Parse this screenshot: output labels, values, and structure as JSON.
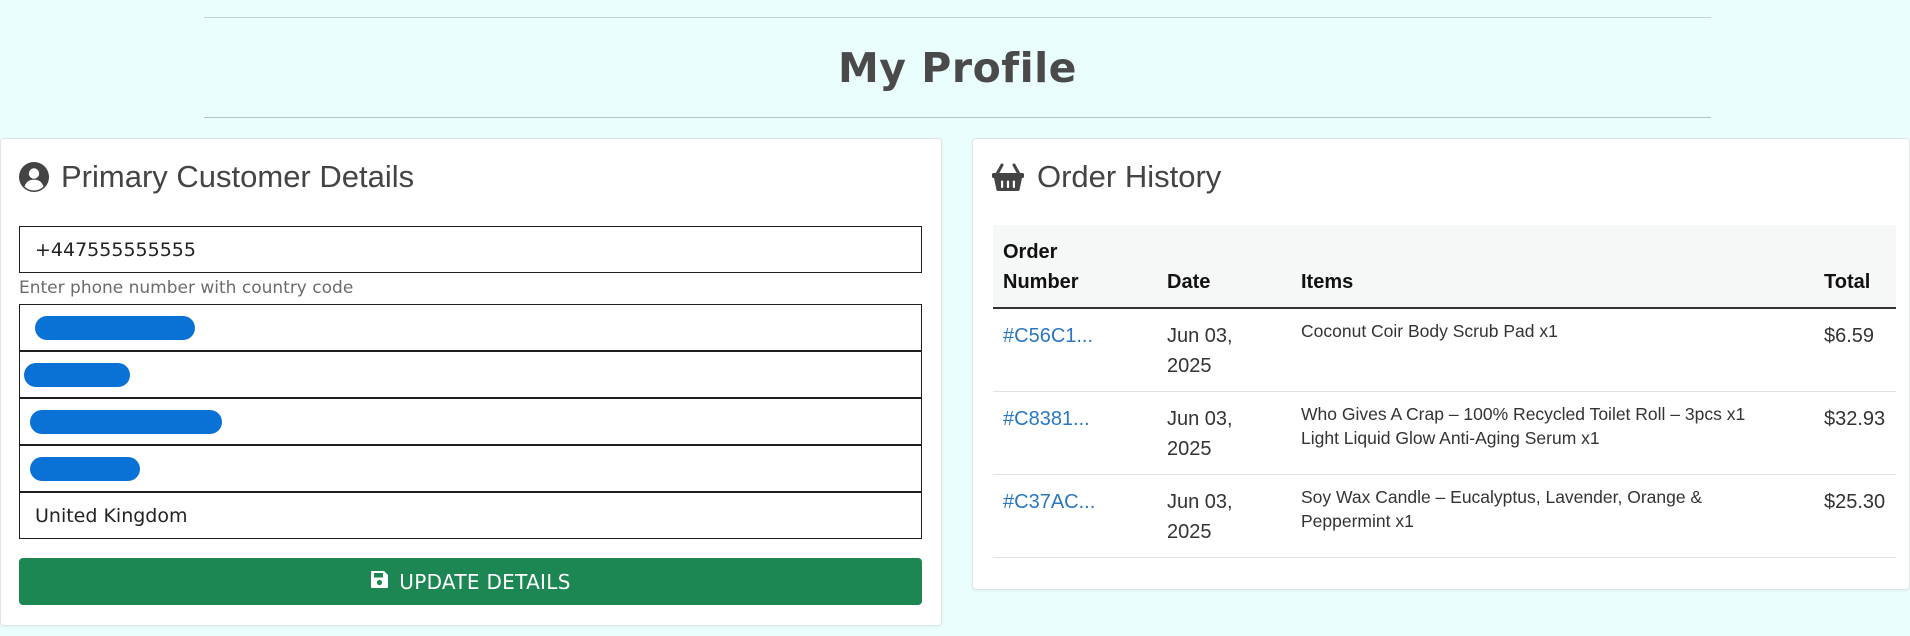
{
  "page": {
    "title": "My Profile"
  },
  "customer": {
    "heading": "Primary Customer Details",
    "phone": "+447555555555",
    "phone_hint": "Enter phone number with country code",
    "country": "United Kingdom",
    "update_label": "UPDATE DETAILS"
  },
  "orders": {
    "heading": "Order History",
    "columns": {
      "number_line1": "Order",
      "number_line2": "Number",
      "date": "Date",
      "items": "Items",
      "total": "Total"
    },
    "rows": [
      {
        "number": "#C56C1...",
        "date_line1": "Jun 03,",
        "date_line2": "2025",
        "items": [
          "Coconut Coir Body Scrub Pad x1"
        ],
        "total": "$6.59"
      },
      {
        "number": "#C8381...",
        "date_line1": "Jun 03,",
        "date_line2": "2025",
        "items": [
          "Who Gives A Crap – 100% Recycled Toilet Roll – 3pcs x1",
          "Light Liquid Glow Anti-Aging Serum x1"
        ],
        "total": "$32.93"
      },
      {
        "number": "#C37AC...",
        "date_line1": "Jun 03,",
        "date_line2": "2025",
        "items": [
          "Soy Wax Candle – Eucalyptus, Lavender, Orange &",
          "Peppermint x1"
        ],
        "total": "$25.30"
      }
    ]
  },
  "colors": {
    "background": "#ebfefe",
    "button": "#1c8752",
    "link": "#2a78c0",
    "redaction": "#0a72d6"
  },
  "icons": {
    "user": "user-circle-icon",
    "basket": "shopping-basket-icon",
    "save": "save-disk-icon"
  }
}
